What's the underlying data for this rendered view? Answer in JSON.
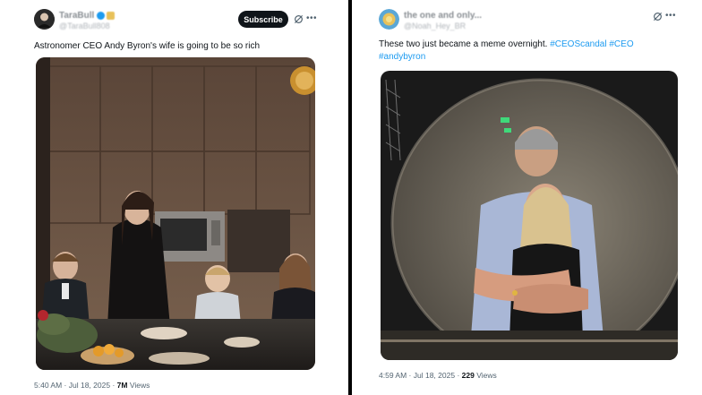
{
  "left_tweet": {
    "author_name": "TaraBull",
    "author_handle": "@TaraBull808",
    "subscribe_label": "Subscribe",
    "text": "Astronomer CEO Andy Byron's wife is going to be so rich",
    "time": "5:40 AM",
    "date": "Jul 18, 2025",
    "views_count": "7M",
    "views_label": "Views"
  },
  "right_tweet": {
    "author_name": "the one and only...",
    "author_handle": "@Noah_Hey_BR",
    "text_plain": "These two just became a meme overnight.",
    "hashtag_1": "#CEOScandal",
    "hashtag_2": "#CEO",
    "hashtag_3": "#andybyron",
    "time": "4:59 AM",
    "date": "Jul 18, 2025",
    "views_count": "229",
    "views_label": "Views"
  },
  "icons": {
    "grok": "grok-icon",
    "more": "more-icon",
    "verified": "verified-badge-icon",
    "affiliate": "affiliate-badge-icon"
  },
  "colors": {
    "accent": "#1d9bf0",
    "text": "#0f1419",
    "muted": "#536471",
    "divider": "#000000"
  }
}
